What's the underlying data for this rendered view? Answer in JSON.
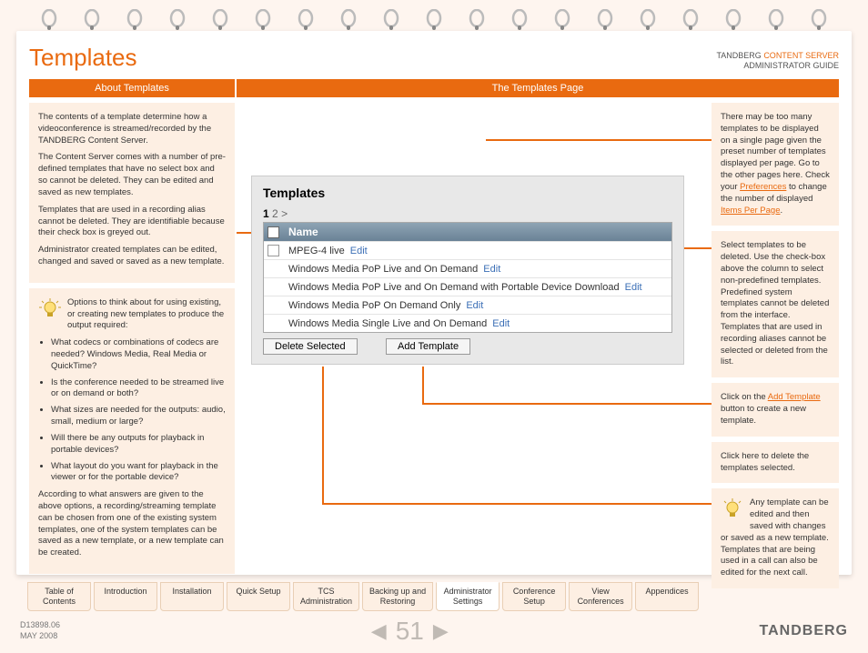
{
  "header": {
    "title": "Templates",
    "brand": "TANDBERG",
    "product": "CONTENT SERVER",
    "subtitle": "ADMINISTRATOR GUIDE"
  },
  "tabs": {
    "left": "About Templates",
    "right": "The Templates Page"
  },
  "left_col": {
    "box1": {
      "p1": "The contents of a template determine how a videoconference is streamed/recorded by the TANDBERG Content Server.",
      "p2": "The Content Server comes with a number of pre-defined templates that have no select box and so cannot be deleted. They can be edited and saved as new templates.",
      "p3": "Templates that are used in a recording alias cannot  be deleted. They are identifiable because their check box is greyed out.",
      "p4": "Administrator created templates can be edited, changed and saved or saved as a new template."
    },
    "box2": {
      "intro": "Options to think about for using existing, or creating new templates to produce the output required:",
      "li1": "What codecs or combinations of codecs are needed? Windows Media, Real Media or QuickTime?",
      "li2": "Is the conference needed to be streamed live or on demand or both?",
      "li3": "What sizes are needed for the outputs: audio, small, medium or large?",
      "li4": "Will there be any outputs for playback in portable devices?",
      "li5": "What layout do you want for playback in the viewer or for the portable device?",
      "outro": "According to what answers are given to the above options, a recording/streaming template can be chosen from one of the existing system templates, one of the system templates can be saved as a new template, or a new template can be created."
    }
  },
  "right_col": {
    "box1_a": "There may be too many templates to be displayed on a single page given the preset number of templates displayed per page. Go to the other pages here. Check your ",
    "box1_link1": "Preferences",
    "box1_b": " to change the number of displayed ",
    "box1_link2": "Items Per Page",
    "box1_c": ".",
    "box2": "Select templates to be deleted. Use the check-box above the column to select non-predefined templates. Predefined system templates cannot be deleted from the interface. Templates that are used in recording aliases cannot be selected or deleted from the list.",
    "box3_a": "Click on the ",
    "box3_link": "Add Template",
    "box3_b": " button to create a new template.",
    "box4": "Click here to delete the templates selected.",
    "box5": "Any template can be edited and then saved with changes or saved as a new template. Templates that are being used in a call can also be edited for the next call."
  },
  "screenshot": {
    "title": "Templates",
    "page_current": "1",
    "page_other": "2",
    "page_arrow": ">",
    "col_name": "Name",
    "edit": "Edit",
    "rows": [
      "MPEG-4 live",
      "Windows Media PoP Live and On Demand",
      "Windows Media PoP Live and On Demand with Portable Device Download",
      "Windows Media PoP On Demand Only",
      "Windows Media Single Live and On Demand"
    ],
    "btn_delete": "Delete Selected",
    "btn_add": "Add Template"
  },
  "nav": {
    "t1a": "Table of",
    "t1b": "Contents",
    "t2": "Introduction",
    "t3": "Installation",
    "t4": "Quick Setup",
    "t5a": "TCS",
    "t5b": "Administration",
    "t6a": "Backing up and",
    "t6b": "Restoring",
    "t7a": "Administrator",
    "t7b": "Settings",
    "t8a": "Conference",
    "t8b": "Setup",
    "t9a": "View",
    "t9b": "Conferences",
    "t10": "Appendices"
  },
  "footer": {
    "ref": "D13898.06",
    "date": "MAY 2008",
    "page": "51",
    "logo": "TANDBERG"
  }
}
